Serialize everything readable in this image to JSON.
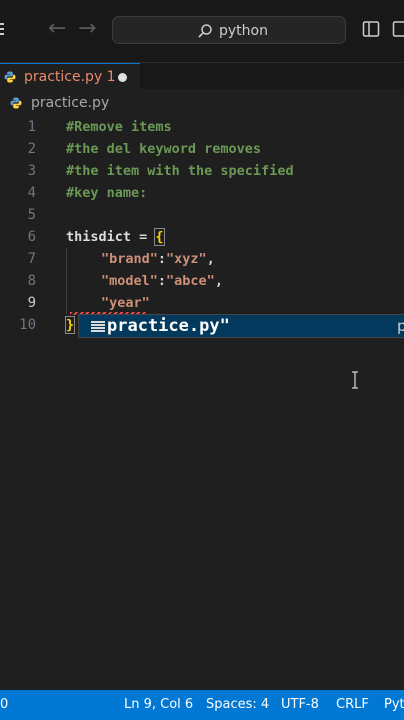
{
  "titlebar": {
    "search_text": "python"
  },
  "tab": {
    "label": "practice.py 1"
  },
  "breadcrumb": {
    "file": "practice.py"
  },
  "editor": {
    "lines": [
      {
        "num": "1",
        "text": "#Remove items"
      },
      {
        "num": "2",
        "text": "#the del keyword removes"
      },
      {
        "num": "3",
        "text": "#the item with the specified"
      },
      {
        "num": "4",
        "text": "#key name:"
      },
      {
        "num": "5",
        "text": ""
      },
      {
        "num": "6",
        "var": "thisdict",
        "op": " = ",
        "brace": "{"
      },
      {
        "num": "7",
        "key": "\"brand\"",
        "colon": ":",
        "val": "\"xyz\"",
        "comma": ","
      },
      {
        "num": "8",
        "key": "\"model\"",
        "colon": ":",
        "val": "\"abce\"",
        "comma": ","
      },
      {
        "num": "9",
        "key": "\"year\""
      },
      {
        "num": "10",
        "brace": "}"
      }
    ],
    "active_line": 9
  },
  "suggest": {
    "label": "practice.py\"",
    "detail": "p"
  },
  "status": {
    "left": "0",
    "position": "Ln 9, Col 6",
    "spaces": "Spaces: 4",
    "encoding": "UTF-8",
    "eol": "CRLF",
    "language": "Pyt"
  },
  "colors": {
    "accent": "#0078d4",
    "comment": "#6a9955",
    "string": "#ce9178",
    "modified_tab": "#e78a6c"
  }
}
